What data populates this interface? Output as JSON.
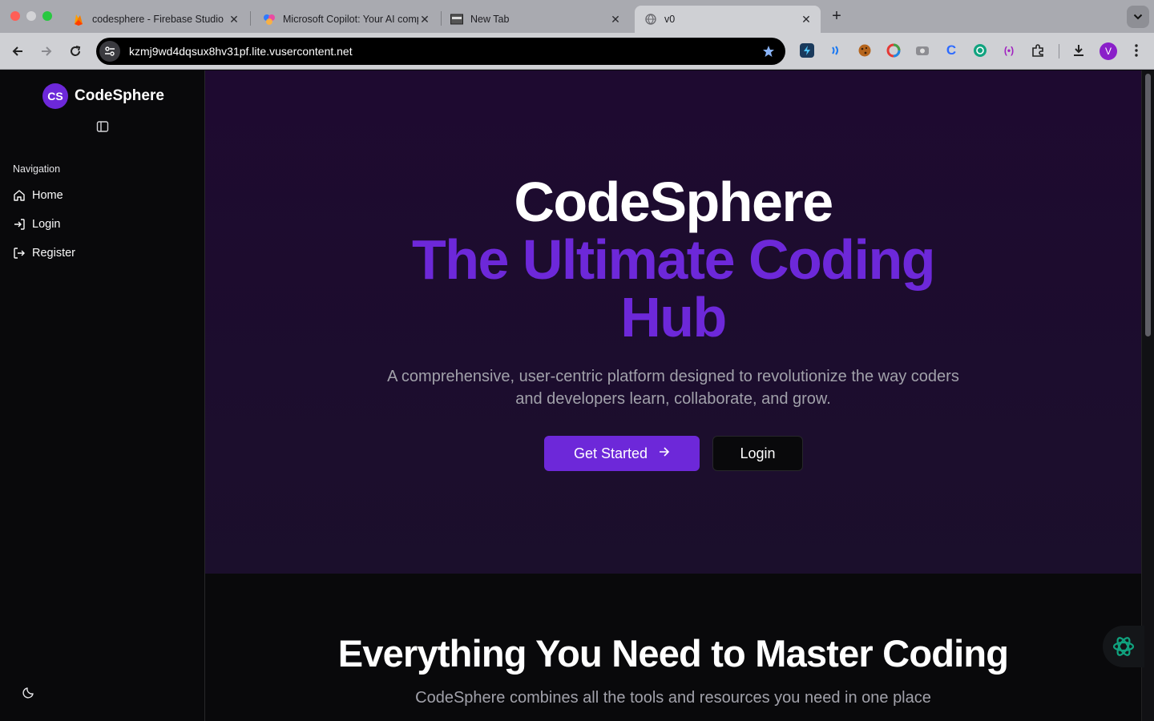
{
  "browser": {
    "tabs": [
      {
        "title": "codesphere - Firebase Studio",
        "icon": "firebase-icon"
      },
      {
        "title": "Microsoft Copilot: Your AI companion",
        "icon": "copilot-icon"
      },
      {
        "title": "New Tab",
        "icon": "new-tab-icon"
      },
      {
        "title": "v0",
        "icon": "globe-icon",
        "active": true
      }
    ],
    "url": "kzmj9wd4dqsux8hv31pf.lite.vusercontent.net",
    "profile_initial": "V"
  },
  "sidebar": {
    "brand_initials": "CS",
    "brand_name": "CodeSphere",
    "nav_label": "Navigation",
    "items": [
      {
        "label": "Home",
        "icon": "home-icon"
      },
      {
        "label": "Login",
        "icon": "log-in-icon"
      },
      {
        "label": "Register",
        "icon": "log-out-icon"
      }
    ]
  },
  "hero": {
    "title": "CodeSphere",
    "subtitle": "The Ultimate Coding Hub",
    "description": "A comprehensive, user-centric platform designed to revolutionize the way coders and developers learn, collaborate, and grow.",
    "primary_button": "Get Started",
    "secondary_button": "Login"
  },
  "features": {
    "title": "Everything You Need to Master Coding",
    "subtitle": "CodeSphere combines all the tools and resources you need in one place"
  },
  "colors": {
    "accent": "#6d28d9",
    "hero_bg": "#1e0a30",
    "page_bg": "#09090b"
  }
}
